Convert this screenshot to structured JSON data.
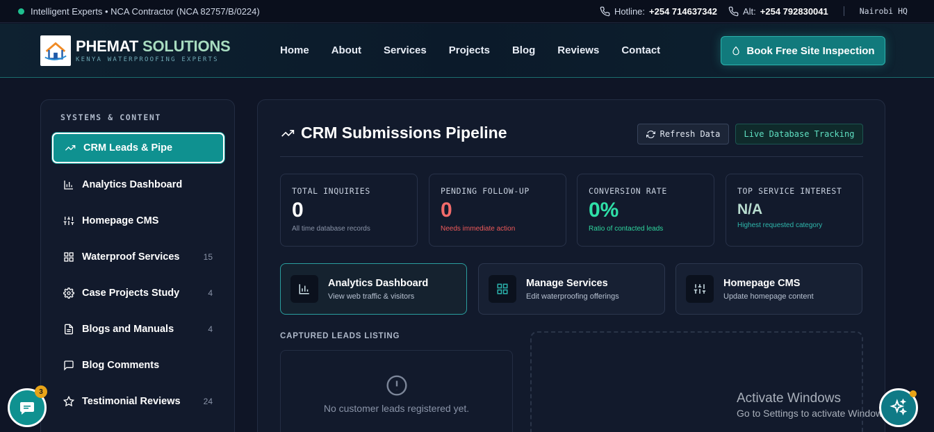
{
  "topbar": {
    "tagline": "Intelligent Experts • NCA Contractor (NCA 82757/B/0224)",
    "hotline_label": "Hotline:",
    "hotline_number": "+254 714637342",
    "alt_label": "Alt:",
    "alt_number": "+254 792830041",
    "location": "Nairobi HQ"
  },
  "brand": {
    "name_part1": "PHEMAT",
    "name_part2": "SOLUTIONS",
    "tagline": "KENYA WATERPROOFING EXPERTS"
  },
  "nav": {
    "items": [
      "Home",
      "About",
      "Services",
      "Projects",
      "Blog",
      "Reviews",
      "Contact"
    ],
    "cta": "Book Free Site Inspection"
  },
  "sidebar": {
    "section_title": "SYSTEMS & CONTENT",
    "items": [
      {
        "label": "CRM Leads & Pipe",
        "icon": "trending-up-icon",
        "count": ""
      },
      {
        "label": "Analytics Dashboard",
        "icon": "bar-chart-icon",
        "count": ""
      },
      {
        "label": "Homepage CMS",
        "icon": "sliders-icon",
        "count": ""
      },
      {
        "label": "Waterproof Services",
        "icon": "grid-icon",
        "count": "15"
      },
      {
        "label": "Case Projects Study",
        "icon": "gear-icon",
        "count": "4"
      },
      {
        "label": "Blogs and Manuals",
        "icon": "document-icon",
        "count": "4"
      },
      {
        "label": "Blog Comments",
        "icon": "comment-icon",
        "count": ""
      },
      {
        "label": "Testimonial Reviews",
        "icon": "star-icon",
        "count": "24"
      }
    ]
  },
  "main": {
    "title": "CRM Submissions Pipeline",
    "refresh_label": "Refresh Data",
    "live_label": "Live Database Tracking",
    "stats": [
      {
        "label": "TOTAL INQUIRIES",
        "value": "0",
        "sub": "All time database records",
        "color": "#ffffff",
        "sub_color": "#8a94a8"
      },
      {
        "label": "PENDING FOLLOW-UP",
        "value": "0",
        "sub": "Needs immediate action",
        "color": "#f26b6b",
        "sub_color": "#ef5a5a"
      },
      {
        "label": "CONVERSION RATE",
        "value": "0%",
        "sub": "Ratio of contacted leads",
        "color": "#2fe0a8",
        "sub_color": "#2fd69e"
      },
      {
        "label": "TOP SERVICE INTEREST",
        "value": "N/A",
        "sub": "Highest requested category",
        "color": "#b8dccf",
        "sub_color": "#2fb8ad"
      }
    ],
    "quick_links": [
      {
        "title": "Analytics Dashboard",
        "desc": "View web traffic & visitors",
        "icon": "bar-chart-icon"
      },
      {
        "title": "Manage Services",
        "desc": "Edit waterproofing offerings",
        "icon": "grid-icon"
      },
      {
        "title": "Homepage CMS",
        "desc": "Update homepage content",
        "icon": "sliders-icon"
      }
    ],
    "leads_title": "CAPTURED LEADS LISTING",
    "leads_empty": "No customer leads registered yet."
  },
  "overlays": {
    "chat_badge": "3",
    "activate_title": "Activate Windows",
    "activate_sub": "Go to Settings to activate Windows."
  },
  "colors": {
    "accent": "#0f9190",
    "background": "#0f1526",
    "panel": "#121a2c"
  }
}
